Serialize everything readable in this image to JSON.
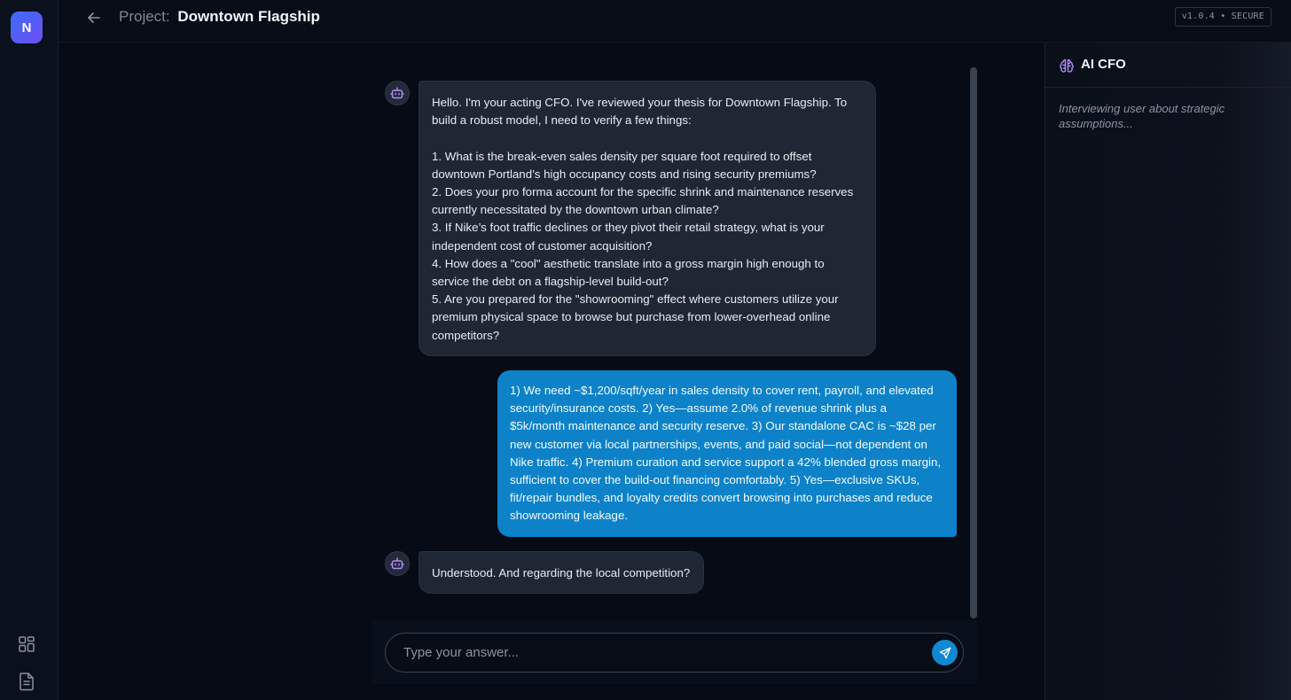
{
  "rail": {
    "logo_letter": "N"
  },
  "header": {
    "project_label": "Project:",
    "project_name": "Downtown Flagship",
    "version": "v1.0.4 • SECURE"
  },
  "messages": [
    {
      "role": "assistant",
      "text": "Hello. I'm your acting CFO. I've reviewed your thesis for Downtown Flagship. To build a robust model, I need to verify a few things:\n\n1. What is the break-even sales density per square foot required to offset downtown Portland’s high occupancy costs and rising security premiums?\n2. Does your pro forma account for the specific shrink and maintenance reserves currently necessitated by the downtown urban climate?\n3. If Nike’s foot traffic declines or they pivot their retail strategy, what is your independent cost of customer acquisition?\n4. How does a \"cool\" aesthetic translate into a gross margin high enough to service the debt on a flagship-level build-out?\n5. Are you prepared for the \"showrooming\" effect where customers utilize your premium physical space to browse but purchase from lower-overhead online competitors?"
    },
    {
      "role": "user",
      "text": "1) We need ~$1,200/sqft/year in sales density to cover rent, payroll, and elevated security/insurance costs. 2) Yes—assume 2.0% of revenue shrink plus a $5k/month maintenance and security reserve. 3) Our standalone CAC is ~$28 per new customer via local partnerships, events, and paid social—not dependent on Nike traffic. 4) Premium curation and service support a 42% blended gross margin, sufficient to cover the build-out financing comfortably. 5) Yes—exclusive SKUs, fit/repair bundles, and loyalty credits convert browsing into purchases and reduce showrooming leakage."
    },
    {
      "role": "assistant",
      "text": "Understood. And regarding the local competition?"
    }
  ],
  "composer": {
    "placeholder": "Type your answer..."
  },
  "panel": {
    "title": "AI CFO",
    "status": "Interviewing user about strategic assumptions..."
  },
  "colors": {
    "accent": "#0d82c9",
    "logo_gradient_start": "#3b6cf6",
    "logo_gradient_end": "#6f4ff2",
    "panel_icon": "#b68cff"
  },
  "icons": {
    "back": "arrow-left-icon",
    "bot": "robot-icon",
    "dashboard": "grid-icon",
    "document": "document-icon",
    "send": "send-icon",
    "brain": "brain-icon"
  }
}
